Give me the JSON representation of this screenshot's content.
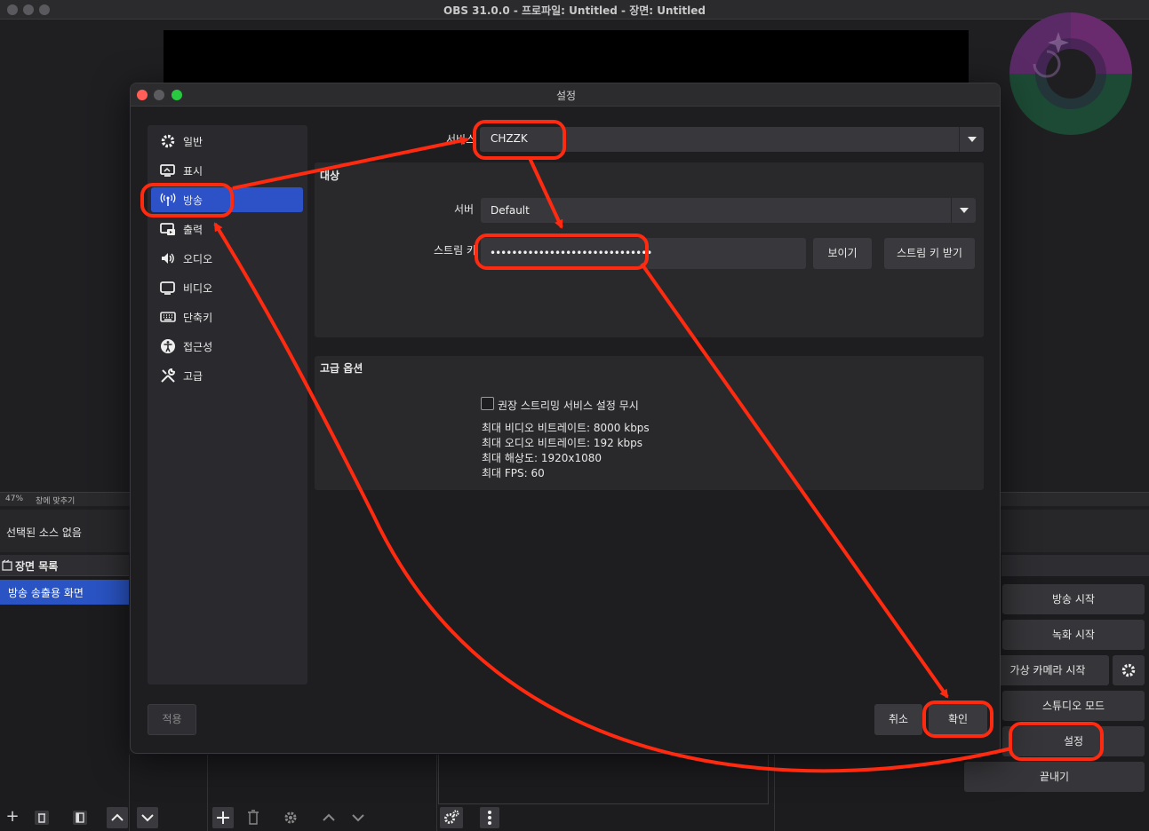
{
  "window": {
    "title": "OBS 31.0.0 - 프로파일: Untitled - 장면: Untitled"
  },
  "preview": {
    "zoom": "47%",
    "fit_label": "창에 맞추기"
  },
  "sources": {
    "empty_label": "선택된 소스 없음"
  },
  "scenes": {
    "title": "장면 목록",
    "items": [
      {
        "label": "방송 송출용 화면"
      }
    ]
  },
  "controls": {
    "start_stream": "방송 시작",
    "start_record": "녹화 시작",
    "start_virtualcam": "가상 카메라 시작",
    "studio_mode": "스튜디오 모드",
    "settings": "설정",
    "exit": "끝내기"
  },
  "dialog": {
    "title": "설정",
    "nav": [
      {
        "label": "일반",
        "icon": "gear-icon"
      },
      {
        "label": "표시",
        "icon": "display-icon"
      },
      {
        "label": "방송",
        "icon": "antenna-icon",
        "active": true
      },
      {
        "label": "출력",
        "icon": "output-icon"
      },
      {
        "label": "오디오",
        "icon": "speaker-icon"
      },
      {
        "label": "비디오",
        "icon": "monitor-icon"
      },
      {
        "label": "단축키",
        "icon": "keyboard-icon"
      },
      {
        "label": "접근성",
        "icon": "accessibility-icon"
      },
      {
        "label": "고급",
        "icon": "tools-icon"
      }
    ],
    "service_label": "서비스",
    "service_value": "CHZZK",
    "destination_title": "대상",
    "server_label": "서버",
    "server_value": "Default",
    "stream_key_label": "스트림 키",
    "stream_key_value": "••••••••••••••••••••••••••••••",
    "show_button": "보이기",
    "get_key_button": "스트림 키 받기",
    "advanced_title": "고급 옵션",
    "ignore_recommended": "권장 스트리밍 서비스 설정 무시",
    "info": [
      "최대 비디오 비트레이트: 8000 kbps",
      "최대 오디오 비트레이트: 192 kbps",
      "최대 해상도: 1920x1080",
      "최대 FPS: 60"
    ],
    "apply": "적용",
    "cancel": "취소",
    "ok": "확인"
  },
  "colors": {
    "accent": "#2d51c7",
    "annotation": "#ff2a10"
  }
}
